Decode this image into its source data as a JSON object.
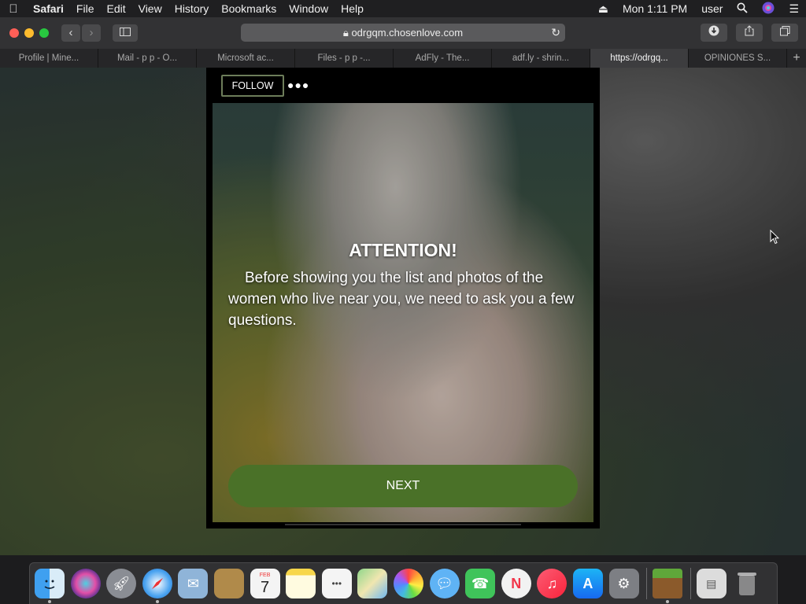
{
  "menubar": {
    "app_name": "Safari",
    "items": [
      "File",
      "Edit",
      "View",
      "History",
      "Bookmarks",
      "Window",
      "Help"
    ],
    "clock": "Mon 1:11 PM",
    "user": "user"
  },
  "toolbar": {
    "url": "odrgqm.chosenlove.com"
  },
  "tabs": [
    {
      "label": "Profile | Mine..."
    },
    {
      "label": "Mail - p p - O..."
    },
    {
      "label": "Microsoft ac..."
    },
    {
      "label": "Files - p p -..."
    },
    {
      "label": "AdFly - The..."
    },
    {
      "label": "adf.ly - shrin..."
    },
    {
      "label": "https://odrgq...",
      "active": true
    },
    {
      "label": "OPINIONES S..."
    }
  ],
  "page": {
    "follow_label": "FOLLOW",
    "more_label": "●●●",
    "heading": "ATTENTION!",
    "message": "Before showing you the list and photos of the women who live near you, we need to ask you a few questions.",
    "next_label": "NEXT"
  },
  "dock": {
    "apps": [
      "Finder",
      "Siri",
      "Launchpad",
      "Safari",
      "Mail",
      "Contacts",
      "Calendar",
      "Notes",
      "Reminders",
      "Maps",
      "Photos",
      "Messages",
      "FaceTime",
      "News",
      "Music",
      "App Store",
      "System Preferences",
      "Minecraft",
      "Downloads",
      "Trash"
    ],
    "calendar_day": "7",
    "calendar_month": "FEB"
  },
  "colors": {
    "accent_green": "#4a7128",
    "follow_border": "#6d7d5a"
  }
}
